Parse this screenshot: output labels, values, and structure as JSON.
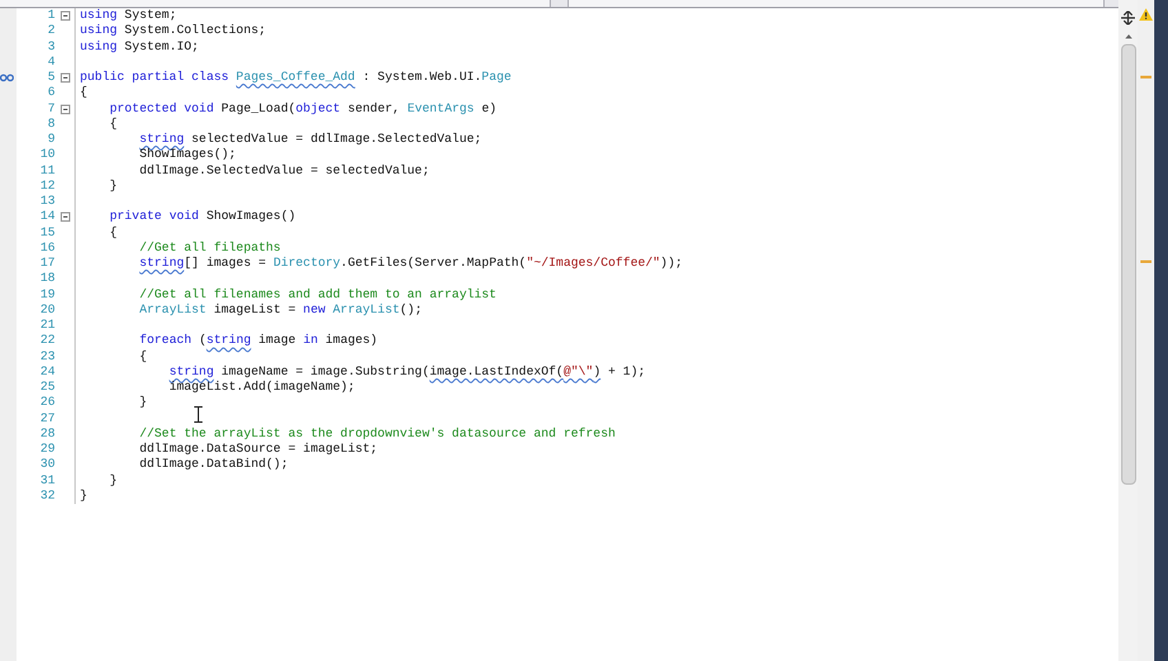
{
  "editor": {
    "lines": [
      {
        "number": "1",
        "foldable": true,
        "tokens": [
          {
            "kind": "keyword",
            "text": "using"
          },
          {
            "kind": "plain",
            "text": " System;"
          }
        ]
      },
      {
        "number": "2",
        "foldable": false,
        "tokens": [
          {
            "kind": "keyword",
            "text": "using"
          },
          {
            "kind": "plain",
            "text": " System.Collections;"
          }
        ]
      },
      {
        "number": "3",
        "foldable": false,
        "tokens": [
          {
            "kind": "keyword",
            "text": "using"
          },
          {
            "kind": "plain",
            "text": " System.IO;"
          }
        ]
      },
      {
        "number": "4",
        "foldable": false
      },
      {
        "number": "5",
        "foldable": true,
        "references": true,
        "tokens": [
          {
            "kind": "keyword",
            "text": "public partial class "
          },
          {
            "kind": "type",
            "text": "Pages_Coffee_Add",
            "underlined": true
          },
          {
            "kind": "plain",
            "text": " : System.Web.UI."
          },
          {
            "kind": "type",
            "text": "Page"
          }
        ]
      },
      {
        "number": "6",
        "foldable": false,
        "tokens": [
          {
            "kind": "plain",
            "text": "{"
          }
        ]
      },
      {
        "number": "7",
        "foldable": true,
        "tokens": [
          {
            "kind": "keyword",
            "text": "    protected void"
          },
          {
            "kind": "plain",
            "text": " Page_Load("
          },
          {
            "kind": "keyword",
            "text": "object"
          },
          {
            "kind": "plain",
            "text": " sender, "
          },
          {
            "kind": "type",
            "text": "EventArgs"
          },
          {
            "kind": "plain",
            "text": " e)"
          }
        ]
      },
      {
        "number": "8",
        "foldable": false,
        "tokens": [
          {
            "kind": "plain",
            "text": "    {"
          }
        ]
      },
      {
        "number": "9",
        "foldable": false,
        "tokens": [
          {
            "kind": "keyword",
            "text": "        string",
            "underlined": true
          },
          {
            "kind": "plain",
            "text": " selectedValue = ddlImage.SelectedValue;"
          }
        ]
      },
      {
        "number": "10",
        "foldable": false,
        "tokens": [
          {
            "kind": "plain",
            "text": "        ShowImages();"
          }
        ]
      },
      {
        "number": "11",
        "foldable": false,
        "tokens": [
          {
            "kind": "plain",
            "text": "        ddlImage.SelectedValue = selectedValue;"
          }
        ]
      },
      {
        "number": "12",
        "foldable": false,
        "tokens": [
          {
            "kind": "plain",
            "text": "    }"
          }
        ]
      },
      {
        "number": "13",
        "foldable": false
      },
      {
        "number": "14",
        "foldable": true,
        "tokens": [
          {
            "kind": "keyword",
            "text": "    private void"
          },
          {
            "kind": "plain",
            "text": " ShowImages()"
          }
        ]
      },
      {
        "number": "15",
        "foldable": false,
        "tokens": [
          {
            "kind": "plain",
            "text": "    {"
          }
        ]
      },
      {
        "number": "16",
        "foldable": false,
        "tokens": [
          {
            "kind": "comment",
            "text": "        //Get all filepaths"
          }
        ]
      },
      {
        "number": "17",
        "foldable": false,
        "tokens": [
          {
            "kind": "keyword",
            "text": "        string",
            "underlined": true
          },
          {
            "kind": "plain",
            "text": "[] images = "
          },
          {
            "kind": "type",
            "text": "Directory"
          },
          {
            "kind": "plain",
            "text": ".GetFiles(Server.MapPath("
          },
          {
            "kind": "string",
            "text": "\"~/Images/Coffee/\""
          },
          {
            "kind": "plain",
            "text": "));"
          }
        ]
      },
      {
        "number": "18",
        "foldable": false
      },
      {
        "number": "19",
        "foldable": false,
        "tokens": [
          {
            "kind": "comment",
            "text": "        //Get all filenames and add them to an arraylist"
          }
        ]
      },
      {
        "number": "20",
        "foldable": false,
        "tokens": [
          {
            "kind": "type",
            "text": "        ArrayList"
          },
          {
            "kind": "plain",
            "text": " imageList = "
          },
          {
            "kind": "keyword",
            "text": "new"
          },
          {
            "kind": "type",
            "text": " ArrayList"
          },
          {
            "kind": "plain",
            "text": "();"
          }
        ]
      },
      {
        "number": "21",
        "foldable": false
      },
      {
        "number": "22",
        "foldable": false,
        "tokens": [
          {
            "kind": "keyword",
            "text": "        foreach"
          },
          {
            "kind": "plain",
            "text": " ("
          },
          {
            "kind": "keyword",
            "text": "string",
            "underlined": true
          },
          {
            "kind": "plain",
            "text": " image "
          },
          {
            "kind": "keyword",
            "text": "in"
          },
          {
            "kind": "plain",
            "text": " images)"
          }
        ]
      },
      {
        "number": "23",
        "foldable": false,
        "tokens": [
          {
            "kind": "plain",
            "text": "        {"
          }
        ]
      },
      {
        "number": "24",
        "foldable": false,
        "tokens": [
          {
            "kind": "keyword",
            "text": "            string",
            "underlined": true
          },
          {
            "kind": "plain",
            "text": " imageName = image.Substring("
          },
          {
            "kind": "plain",
            "text": "image.LastIndexOf(",
            "underlined": true
          },
          {
            "kind": "string",
            "text": "@\"\\\"",
            "underlined": true
          },
          {
            "kind": "plain",
            "text": ")",
            "underlined": true
          },
          {
            "kind": "plain",
            "text": " + 1);"
          }
        ]
      },
      {
        "number": "25",
        "foldable": false,
        "tokens": [
          {
            "kind": "plain",
            "text": "            imageList.Add(imageName);"
          }
        ]
      },
      {
        "number": "26",
        "foldable": false,
        "tokens": [
          {
            "kind": "plain",
            "text": "        }"
          }
        ]
      },
      {
        "number": "27",
        "foldable": false
      },
      {
        "number": "28",
        "foldable": false,
        "tokens": [
          {
            "kind": "comment",
            "text": "        //Set the arrayList as the dropdownview's datasource and refresh"
          }
        ]
      },
      {
        "number": "29",
        "foldable": false,
        "tokens": [
          {
            "kind": "plain",
            "text": "        ddlImage.DataSource = imageList;"
          }
        ]
      },
      {
        "number": "30",
        "foldable": false,
        "tokens": [
          {
            "kind": "plain",
            "text": "        ddlImage.DataBind();"
          }
        ]
      },
      {
        "number": "31",
        "foldable": false,
        "tokens": [
          {
            "kind": "plain",
            "text": "    }"
          }
        ]
      },
      {
        "number": "32",
        "foldable": false,
        "tokens": [
          {
            "kind": "plain",
            "text": "}"
          }
        ]
      }
    ]
  }
}
